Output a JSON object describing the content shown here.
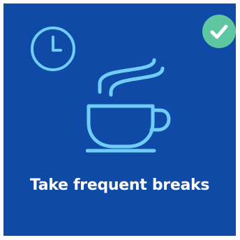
{
  "card": {
    "caption": "Take frequent breaks",
    "selected": true,
    "icons": {
      "main": "coffee-cup-icon",
      "corner": "clock-icon",
      "status": "check-circle-icon"
    }
  },
  "colors": {
    "background": "#0f4aa6",
    "icon": "#6fcdf6",
    "check_badge": "#5ec7a2",
    "text": "#ffffff"
  }
}
